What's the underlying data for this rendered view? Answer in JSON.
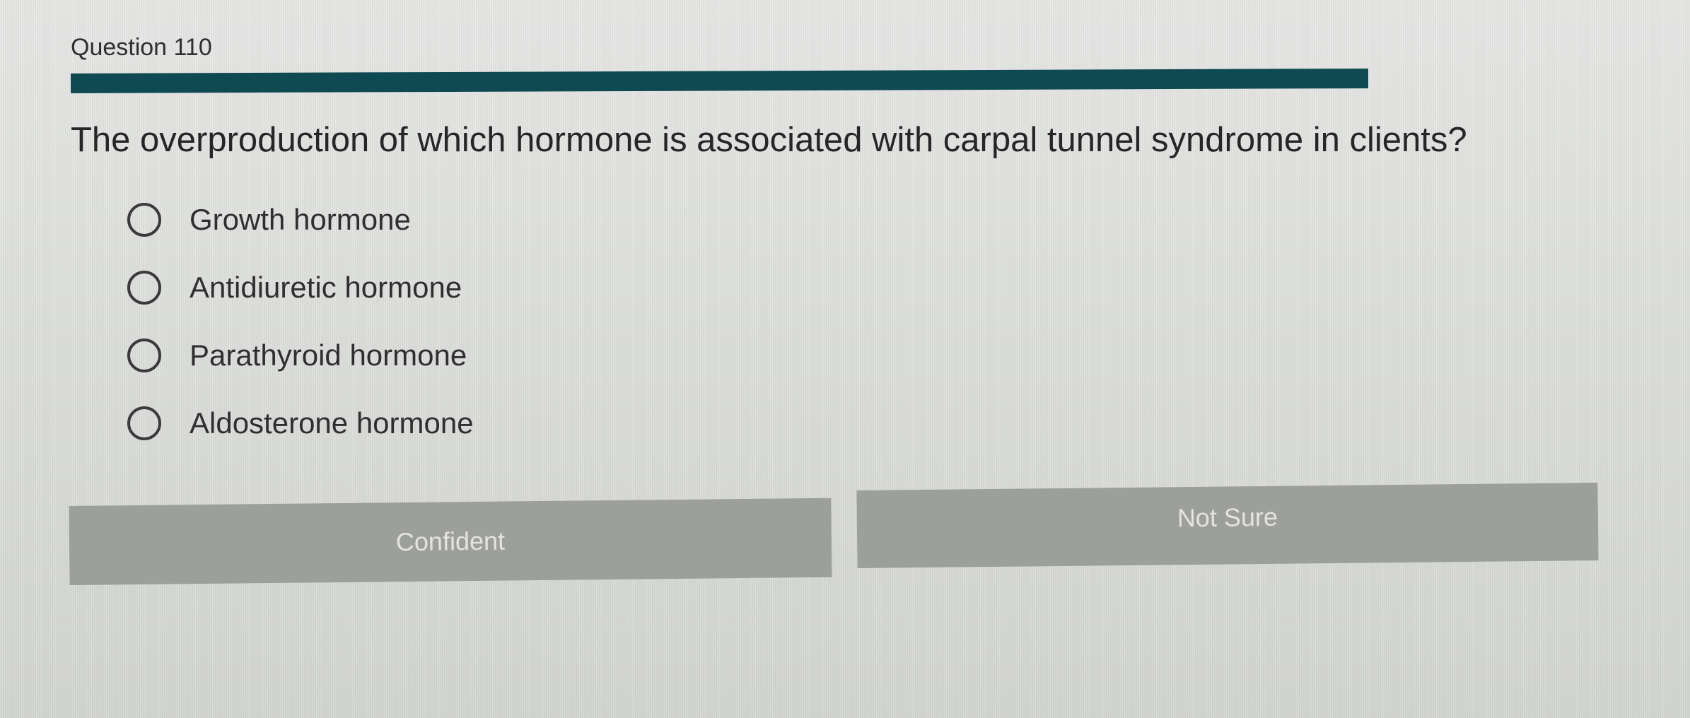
{
  "question": {
    "label": "Question 110",
    "stem": "The overproduction of which hormone is associated with carpal tunnel syndrome in clients?",
    "options": [
      {
        "label": "Growth hormone"
      },
      {
        "label": "Antidiuretic hormone"
      },
      {
        "label": "Parathyroid hormone"
      },
      {
        "label": "Aldosterone hormone"
      }
    ]
  },
  "buttons": {
    "confident_label": "Confident",
    "not_sure_label": "Not Sure"
  },
  "colors": {
    "progress_bar": "#0f4a52",
    "button_bg": "#9d9f9d"
  }
}
